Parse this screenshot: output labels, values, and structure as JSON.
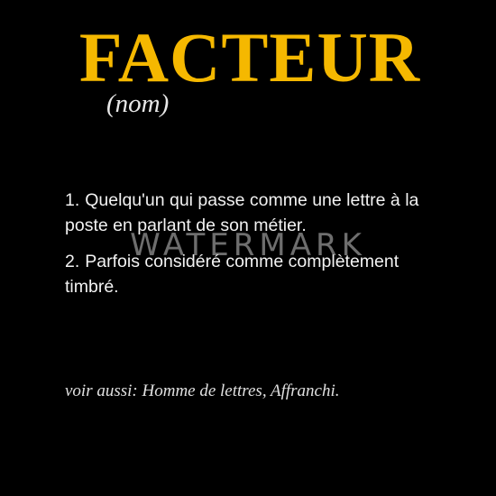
{
  "headword": "FACTEUR",
  "part_of_speech": "(nom)",
  "definitions": [
    {
      "number": "1.",
      "text": "Quelqu'un qui passe comme une lettre à la poste en parlant de son métier."
    },
    {
      "number": "2.",
      "text": "Parfois considéré comme complètement timbré."
    }
  ],
  "see_also": "voir aussi: Homme de lettres, Affranchi.",
  "watermark": "WATERMARK",
  "colors": {
    "background": "#000000",
    "headword": "#f5b800",
    "text": "#f2f2f2"
  }
}
